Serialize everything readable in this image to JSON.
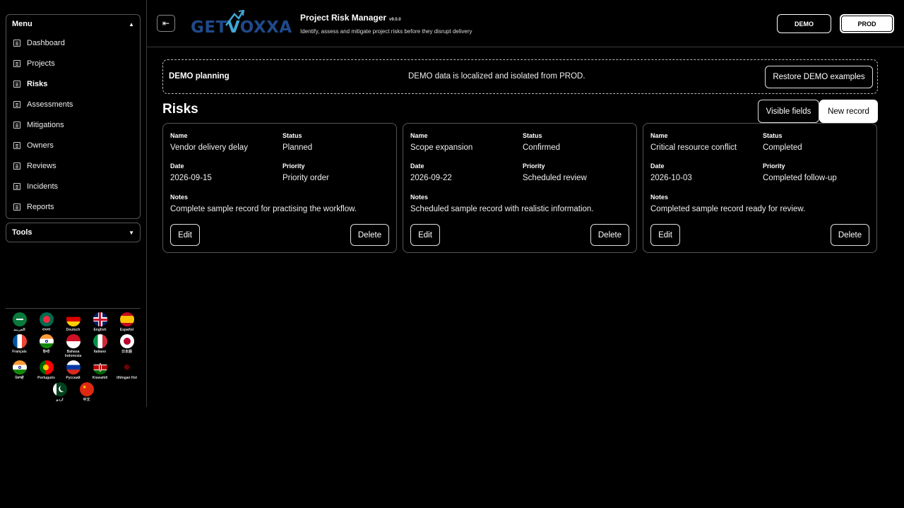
{
  "sidebar": {
    "menu_label": "Menu",
    "items": [
      {
        "label": "Dashboard"
      },
      {
        "label": "Projects"
      },
      {
        "label": "Risks"
      },
      {
        "label": "Assessments"
      },
      {
        "label": "Mitigations"
      },
      {
        "label": "Owners"
      },
      {
        "label": "Reviews"
      },
      {
        "label": "Incidents"
      },
      {
        "label": "Reports"
      }
    ],
    "active_item": "Risks",
    "tools_label": "Tools",
    "languages": [
      {
        "name": "العربية",
        "flag": "sa-flag"
      },
      {
        "name": "বাংলা",
        "flag": "bd-flag"
      },
      {
        "name": "Deutsch",
        "flag": "de-flag"
      },
      {
        "name": "English",
        "flag": "gb-flag"
      },
      {
        "name": "Español",
        "flag": "es-flag"
      },
      {
        "name": "Français",
        "flag": "fr-flag"
      },
      {
        "name": "हिन्दी",
        "flag": "in-flag"
      },
      {
        "name": "Bahasa Indonesia",
        "flag": "id-flag"
      },
      {
        "name": "Italiano",
        "flag": "it-flag"
      },
      {
        "name": "日本語",
        "flag": "jp-flag"
      },
      {
        "name": "ਪੰਜਾਬੀ",
        "flag": "in-flag"
      },
      {
        "name": "Português",
        "flag": "pt-flag"
      },
      {
        "name": "Русский",
        "flag": "ru-flag"
      },
      {
        "name": "Kiswahili",
        "flag": "ke-flag"
      },
      {
        "name": "tlhIngan Hol",
        "flag": "klingon-emblem"
      },
      {
        "name": "اردو",
        "flag": "pk-flag"
      },
      {
        "name": "中文",
        "flag": "cn-flag"
      }
    ]
  },
  "header": {
    "logo_text_a": "GET",
    "logo_text_b": "V",
    "logo_text_c": "OXXA",
    "title": "Project Risk Manager",
    "version": "v9.0.0",
    "subtitle": "Identify, assess and mitigate project risks before they disrupt delivery",
    "env_demo": "DEMO",
    "env_prod": "PROD"
  },
  "banner": {
    "title": "DEMO planning",
    "message": "DEMO data is localized and isolated from PROD.",
    "restore_label": "Restore DEMO examples"
  },
  "main": {
    "title": "Risks",
    "visible_fields_label": "Visible fields",
    "new_record_label": "New record",
    "field_labels": {
      "name": "Name",
      "status": "Status",
      "date": "Date",
      "priority": "Priority",
      "notes": "Notes"
    },
    "edit_label": "Edit",
    "delete_label": "Delete",
    "records": [
      {
        "name": "Vendor delivery delay",
        "status": "Planned",
        "date": "2026-09-15",
        "priority": "Priority order",
        "notes": "Complete sample record for practising the workflow."
      },
      {
        "name": "Scope expansion",
        "status": "Confirmed",
        "date": "2026-09-22",
        "priority": "Scheduled review",
        "notes": "Scheduled sample record with realistic information."
      },
      {
        "name": "Critical resource conflict",
        "status": "Completed",
        "date": "2026-10-03",
        "priority": "Completed follow-up",
        "notes": "Completed sample record ready for review."
      }
    ]
  }
}
